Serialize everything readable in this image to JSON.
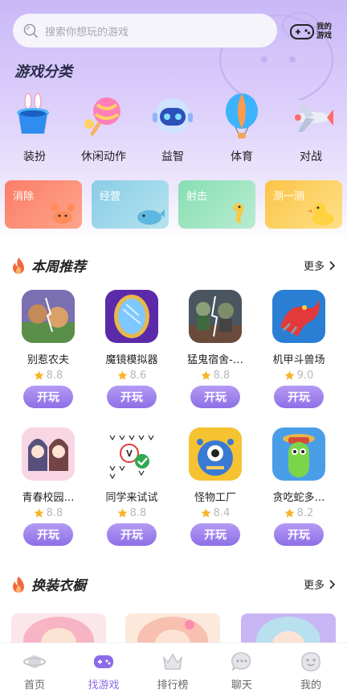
{
  "search": {
    "placeholder": "搜索你想玩的游戏"
  },
  "my_games": {
    "label": "我的游戏"
  },
  "categories": {
    "title": "游戏分类",
    "items": [
      {
        "label": "装扮",
        "icon": "bunny-hat-icon"
      },
      {
        "label": "休闲动作",
        "icon": "candy-icon"
      },
      {
        "label": "益智",
        "icon": "robot-icon"
      },
      {
        "label": "体育",
        "icon": "hot-air-balloon-icon"
      },
      {
        "label": "对战",
        "icon": "airplane-icon"
      }
    ]
  },
  "tiles": [
    {
      "label": "消除",
      "color": "#fb8a6c",
      "icon": "crab-icon"
    },
    {
      "label": "经营",
      "color": "#8fd3e6",
      "icon": "whale-icon"
    },
    {
      "label": "射击",
      "color": "#8ee0b8",
      "icon": "seahorse-icon"
    },
    {
      "label": "测一测",
      "color": "#fcc94a",
      "icon": "duck-icon"
    }
  ],
  "weekly": {
    "title": "本周推荐",
    "more": "更多",
    "play_label": "开玩",
    "games": [
      {
        "name": "别惹农夫",
        "rating": "8.8"
      },
      {
        "name": "魔镜模拟器",
        "rating": "8.6"
      },
      {
        "name": "猛鬼宿舍-…",
        "rating": "8.8"
      },
      {
        "name": "机甲斗兽场",
        "rating": "9.0"
      },
      {
        "name": "青春校园…",
        "rating": "8.8"
      },
      {
        "name": "同学来试试",
        "rating": "8.8"
      },
      {
        "name": "怪物工厂",
        "rating": "8.4"
      },
      {
        "name": "贪吃蛇多…",
        "rating": "8.2"
      }
    ]
  },
  "wardrobe": {
    "title": "换装衣橱",
    "more": "更多"
  },
  "tabbar": {
    "items": [
      {
        "label": "首页",
        "icon": "planet-icon",
        "active": false
      },
      {
        "label": "找游戏",
        "icon": "gamepad-icon",
        "active": true
      },
      {
        "label": "排行榜",
        "icon": "crown-icon",
        "active": false
      },
      {
        "label": "聊天",
        "icon": "chat-bubble-icon",
        "active": false
      },
      {
        "label": "我的",
        "icon": "smiley-face-icon",
        "active": false
      }
    ]
  },
  "colors": {
    "accent": "#8b6be8",
    "star": "#f5b52b"
  }
}
